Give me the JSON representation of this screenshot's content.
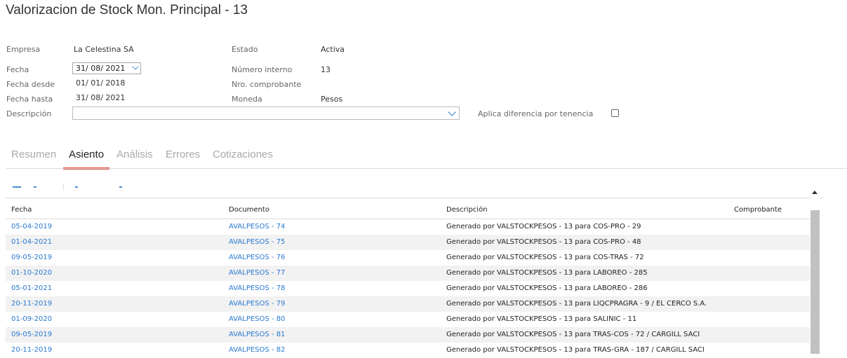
{
  "page": {
    "title": "Valorizacion de Stock Mon. Principal - 13"
  },
  "form": {
    "empresa_label": "Empresa",
    "empresa_value": "La Celestina SA",
    "fecha_label": "Fecha",
    "fecha_value": "31/ 08/ 2021",
    "fecha_desde_label": "Fecha desde",
    "fecha_desde_value": "01/ 01/ 2018",
    "fecha_hasta_label": "Fecha hasta",
    "fecha_hasta_value": "31/ 08/ 2021",
    "descripcion_label": "Descripción",
    "descripcion_value": "",
    "estado_label": "Estado",
    "estado_value": "Activa",
    "numero_interno_label": "Número interno",
    "numero_interno_value": "13",
    "nro_comprobante_label": "Nro. comprobante",
    "nro_comprobante_value": "",
    "moneda_label": "Moneda",
    "moneda_value": "Pesos",
    "aplica_label": "Aplica diferencia por tenencia",
    "aplica_checked": false
  },
  "tabs": [
    {
      "label": "Resumen",
      "active": false
    },
    {
      "label": "Asiento",
      "active": true
    },
    {
      "label": "Análisis",
      "active": false
    },
    {
      "label": "Errores",
      "active": false
    },
    {
      "label": "Cotizaciones",
      "active": false
    }
  ],
  "table": {
    "headers": [
      "Fecha",
      "Documento",
      "Descripción",
      "Comprobante"
    ],
    "rows": [
      [
        "05-04-2019",
        "AVALPESOS - 74",
        "Generado por VALSTOCKPESOS - 13 para COS-PRO - 29",
        ""
      ],
      [
        "01-04-2021",
        "AVALPESOS - 75",
        "Generado por VALSTOCKPESOS - 13 para COS-PRO - 48",
        ""
      ],
      [
        "09-05-2019",
        "AVALPESOS - 76",
        "Generado por VALSTOCKPESOS - 13 para COS-TRAS - 72",
        ""
      ],
      [
        "01-10-2020",
        "AVALPESOS - 77",
        "Generado por VALSTOCKPESOS - 13 para LABOREO - 285",
        ""
      ],
      [
        "05-01-2021",
        "AVALPESOS - 78",
        "Generado por VALSTOCKPESOS - 13 para LABOREO - 286",
        ""
      ],
      [
        "20-11-2019",
        "AVALPESOS - 79",
        "Generado por VALSTOCKPESOS - 13 para LIQCPRAGRA - 9 / EL CERCO S.A.",
        ""
      ],
      [
        "01-09-2020",
        "AVALPESOS - 80",
        "Generado por VALSTOCKPESOS - 13 para SALINIC - 11",
        ""
      ],
      [
        "09-05-2019",
        "AVALPESOS - 81",
        "Generado por VALSTOCKPESOS - 13 para TRAS-COS - 72 / CARGILL SACI",
        ""
      ],
      [
        "20-11-2019",
        "AVALPESOS - 82",
        "Generado por VALSTOCKPESOS - 13 para TRAS-GRA - 187 / CARGILL SACI",
        ""
      ]
    ]
  },
  "colors": {
    "accent": "#e04a3c",
    "link": "#2a7ad0"
  }
}
